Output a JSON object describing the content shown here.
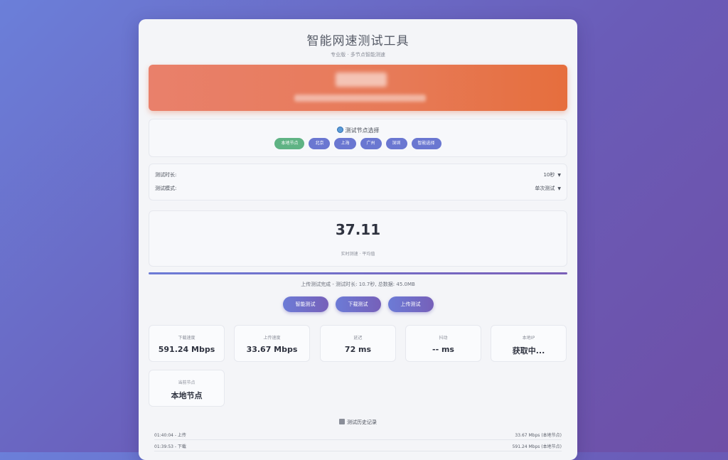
{
  "header": {
    "title": "智能网速测试工具",
    "subtitle": "专业版 · 多节点智能测速"
  },
  "nodes": {
    "title": "测试节点选择",
    "items": [
      "本地节点",
      "北京",
      "上海",
      "广州",
      "深圳",
      "智能选择"
    ],
    "active_index": 0
  },
  "settings": {
    "duration_label": "测试时长:",
    "duration_value": "10秒",
    "mode_label": "测试模式:",
    "mode_value": "单次测试"
  },
  "result": {
    "value": "37.11",
    "caption": "实时测速 · 平均值"
  },
  "progress": {
    "fraction": 1.0
  },
  "status": "上传测试完成 - 测试时长: 10.7秒, 总数据: 45.0MB",
  "buttons": {
    "smart": "智能测试",
    "download": "下载测试",
    "upload": "上传测试"
  },
  "stats": [
    {
      "label": "下载速度",
      "value": "591.24 Mbps"
    },
    {
      "label": "上传速度",
      "value": "33.67 Mbps"
    },
    {
      "label": "延迟",
      "value": "72 ms"
    },
    {
      "label": "抖动",
      "value": "-- ms"
    },
    {
      "label": "本地IP",
      "value": "获取中..."
    },
    {
      "label": "当前节点",
      "value": "本地节点"
    }
  ],
  "history": {
    "title": "测试历史记录",
    "rows": [
      {
        "time": "01:40:04 - 上传",
        "result": "33.67 Mbps (本地节点)"
      },
      {
        "time": "01:39:53 - 下载",
        "result": "591.24 Mbps (本地节点)"
      }
    ]
  },
  "colors": {
    "accent": "#6a77d1",
    "banner": "#e77a57",
    "active_chip": "#5fb384"
  }
}
